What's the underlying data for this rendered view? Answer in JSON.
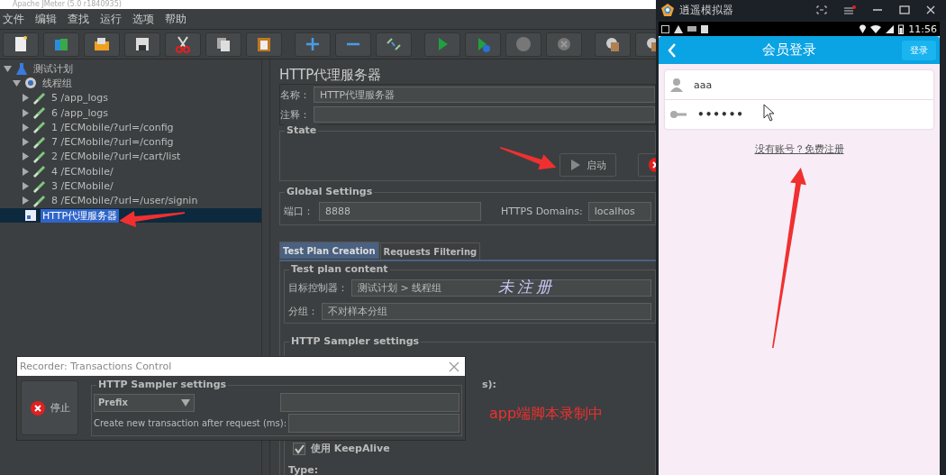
{
  "jmeter": {
    "title": "Apache JMeter (5.0 r1840935)",
    "menu": [
      "文件",
      "编辑",
      "查找",
      "运行",
      "选项",
      "帮助"
    ],
    "tree": [
      {
        "label": "测试计划",
        "kind": "test-plan",
        "expanded": true,
        "selected": false,
        "children": [
          {
            "label": "线程组",
            "kind": "thread-group",
            "expanded": true,
            "selected": false,
            "children": [
              {
                "label": "5 /app_logs",
                "kind": "sampler",
                "expanded": false,
                "selected": false
              },
              {
                "label": "6 /app_logs",
                "kind": "sampler",
                "expanded": false,
                "selected": false
              },
              {
                "label": "1 /ECMobile/?url=/config",
                "kind": "sampler",
                "expanded": false,
                "selected": false
              },
              {
                "label": "7 /ECMobile/?url=/config",
                "kind": "sampler",
                "expanded": false,
                "selected": false
              },
              {
                "label": "2 /ECMobile/?url=/cart/list",
                "kind": "sampler",
                "expanded": false,
                "selected": false
              },
              {
                "label": "4 /ECMobile/",
                "kind": "sampler",
                "expanded": false,
                "selected": false
              },
              {
                "label": "3 /ECMobile/",
                "kind": "sampler",
                "expanded": false,
                "selected": false
              },
              {
                "label": "8 /ECMobile/?url=/user/signin",
                "kind": "sampler",
                "expanded": false,
                "selected": false
              }
            ]
          },
          {
            "label": "HTTP代理服务器",
            "kind": "proxy",
            "selected": true
          }
        ]
      }
    ],
    "panel": {
      "title": "HTTP代理服务器",
      "name_label": "名称：",
      "name_value": "HTTP代理服务器",
      "comment_label": "注释：",
      "state_label": "State",
      "start_button": "启动",
      "global_label": "Global Settings",
      "port_label": "端口：",
      "port_value": "8888",
      "https_label": "HTTPS Domains:",
      "https_value": "localhos",
      "tabs": [
        {
          "label": "Test Plan Creation",
          "selected": true
        },
        {
          "label": "Requests Filtering",
          "selected": false
        }
      ],
      "content_label": "Test plan content",
      "target_label": "目标控制器：",
      "target_value": "测试计划 > 线程组",
      "grouping_label": "分组：",
      "grouping_value": "不对样本分组",
      "sampler_label": "HTTP Sampler settings",
      "hidden_fragment": "s):",
      "keepalive": {
        "label": "使用 KeepAlive",
        "checked": true
      },
      "type_label": "Type:"
    },
    "annotations": [
      {
        "text": "未注册",
        "kind": "handwriting"
      },
      {
        "text": "app端脚本录制中",
        "kind": "caption"
      }
    ],
    "dialog": {
      "title": "Recorder: Transactions Control",
      "stop_button": "停止",
      "group_label": "HTTP Sampler settings",
      "prefix_value": "Prefix",
      "transaction_label": "Create new transaction after request (ms):"
    }
  },
  "emulator": {
    "title": "逍遥模拟器",
    "time": "11:56",
    "app_title": "会员登录",
    "login_button": "登录",
    "username": "aaa",
    "password": "••••••",
    "register_link": "没有账号？免费注册"
  }
}
